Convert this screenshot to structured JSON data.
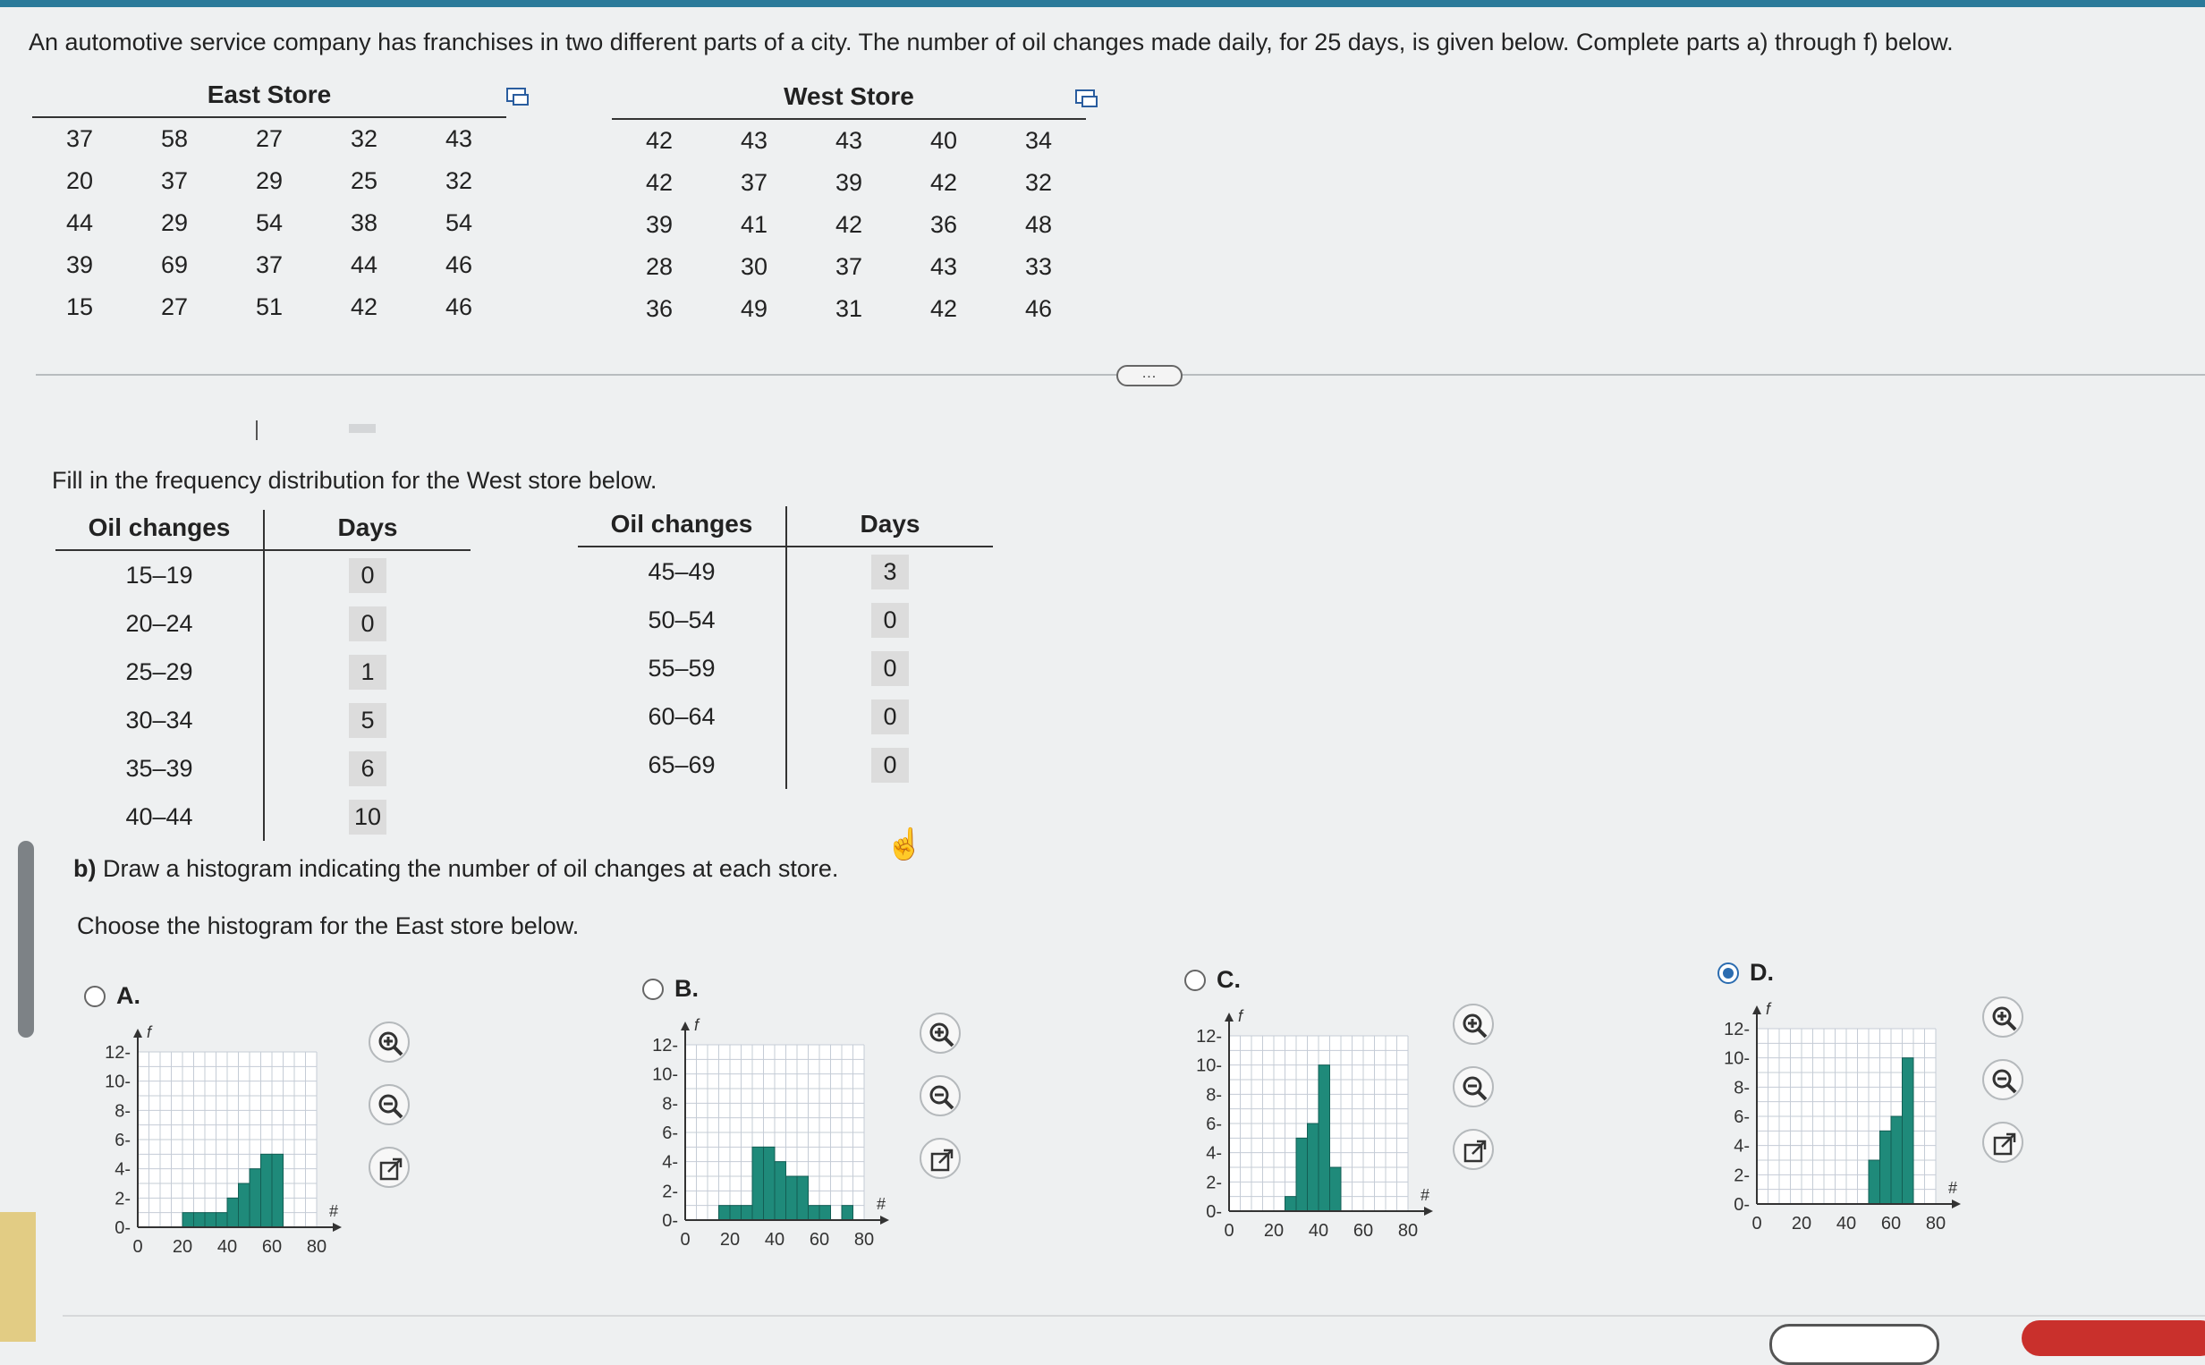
{
  "intro": "An automotive service company has franchises in two different parts of a city. The number of oil changes made daily, for 25 days, is given below. Complete parts a) through f) below.",
  "east_store": {
    "title": "East Store",
    "rows": [
      [
        "37",
        "58",
        "27",
        "32",
        "43"
      ],
      [
        "20",
        "37",
        "29",
        "25",
        "32"
      ],
      [
        "44",
        "29",
        "54",
        "38",
        "54"
      ],
      [
        "39",
        "69",
        "37",
        "44",
        "46"
      ],
      [
        "15",
        "27",
        "51",
        "42",
        "46"
      ]
    ]
  },
  "west_store": {
    "title": "West Store",
    "rows": [
      [
        "42",
        "43",
        "43",
        "40",
        "34"
      ],
      [
        "42",
        "37",
        "39",
        "42",
        "32"
      ],
      [
        "39",
        "41",
        "42",
        "36",
        "48"
      ],
      [
        "28",
        "30",
        "37",
        "43",
        "33"
      ],
      [
        "36",
        "49",
        "31",
        "42",
        "46"
      ]
    ]
  },
  "divider_button": "...",
  "fill_prompt": "Fill in the frequency distribution for the West store below.",
  "freq_left": {
    "headers": [
      "Oil changes",
      "Days"
    ],
    "rows": [
      [
        "15–19",
        "0"
      ],
      [
        "20–24",
        "0"
      ],
      [
        "25–29",
        "1"
      ],
      [
        "30–34",
        "5"
      ],
      [
        "35–39",
        "6"
      ],
      [
        "40–44",
        "10"
      ]
    ]
  },
  "freq_right": {
    "headers": [
      "Oil changes",
      "Days"
    ],
    "rows": [
      [
        "45–49",
        "3"
      ],
      [
        "50–54",
        "0"
      ],
      [
        "55–59",
        "0"
      ],
      [
        "60–64",
        "0"
      ],
      [
        "65–69",
        "0"
      ]
    ]
  },
  "part_b_label": "b)",
  "part_b_text": " Draw a histogram indicating the number of oil changes at each store.",
  "choose_prompt": "Choose the histogram for the East store below.",
  "options": [
    {
      "label": "A.",
      "selected": false
    },
    {
      "label": "B.",
      "selected": false
    },
    {
      "label": "C.",
      "selected": false
    },
    {
      "label": "D.",
      "selected": true
    }
  ],
  "chart_data": [
    {
      "type": "bar",
      "x_label": "#",
      "y_label": "f",
      "xlim": [
        0,
        80
      ],
      "ylim": [
        0,
        12
      ],
      "x_ticks": [
        "0",
        "20",
        "40",
        "60",
        "80"
      ],
      "y_ticks": [
        "0",
        "2",
        "4",
        "6",
        "8",
        "10",
        "12"
      ],
      "bins": [
        [
          20,
          25
        ],
        [
          25,
          30
        ],
        [
          30,
          35
        ],
        [
          35,
          40
        ],
        [
          40,
          45
        ],
        [
          45,
          50
        ],
        [
          50,
          55
        ],
        [
          55,
          60
        ],
        [
          60,
          65
        ]
      ],
      "values": [
        1,
        1,
        1,
        1,
        2,
        3,
        4,
        5,
        5
      ],
      "bar_color": "#1f8a7a"
    },
    {
      "type": "bar",
      "x_label": "#",
      "y_label": "f",
      "xlim": [
        0,
        80
      ],
      "ylim": [
        0,
        12
      ],
      "x_ticks": [
        "0",
        "20",
        "40",
        "60",
        "80"
      ],
      "y_ticks": [
        "0",
        "2",
        "4",
        "6",
        "8",
        "10",
        "12"
      ],
      "bins": [
        [
          15,
          20
        ],
        [
          20,
          25
        ],
        [
          25,
          30
        ],
        [
          30,
          35
        ],
        [
          35,
          40
        ],
        [
          40,
          45
        ],
        [
          45,
          50
        ],
        [
          50,
          55
        ],
        [
          55,
          60
        ],
        [
          60,
          65
        ],
        [
          65,
          70
        ],
        [
          70,
          75
        ]
      ],
      "values": [
        1,
        1,
        1,
        5,
        5,
        4,
        3,
        3,
        1,
        1,
        0,
        1
      ],
      "bar_color": "#1f8a7a"
    },
    {
      "type": "bar",
      "x_label": "#",
      "y_label": "f",
      "xlim": [
        0,
        80
      ],
      "ylim": [
        0,
        12
      ],
      "x_ticks": [
        "0",
        "20",
        "40",
        "60",
        "80"
      ],
      "y_ticks": [
        "0",
        "2",
        "4",
        "6",
        "8",
        "10",
        "12"
      ],
      "bins": [
        [
          25,
          30
        ],
        [
          30,
          35
        ],
        [
          35,
          40
        ],
        [
          40,
          45
        ],
        [
          45,
          50
        ]
      ],
      "values": [
        1,
        5,
        6,
        10,
        3
      ],
      "bar_color": "#1f8a7a"
    },
    {
      "type": "bar",
      "x_label": "#",
      "y_label": "f",
      "xlim": [
        0,
        80
      ],
      "ylim": [
        0,
        12
      ],
      "x_ticks": [
        "0",
        "20",
        "40",
        "60",
        "80"
      ],
      "y_ticks": [
        "0",
        "2",
        "4",
        "6",
        "8",
        "10",
        "12"
      ],
      "bins": [
        [
          50,
          55
        ],
        [
          55,
          60
        ],
        [
          60,
          65
        ],
        [
          65,
          70
        ]
      ],
      "values": [
        3,
        5,
        6,
        10
      ],
      "bar_color": "#1f8a7a"
    }
  ]
}
